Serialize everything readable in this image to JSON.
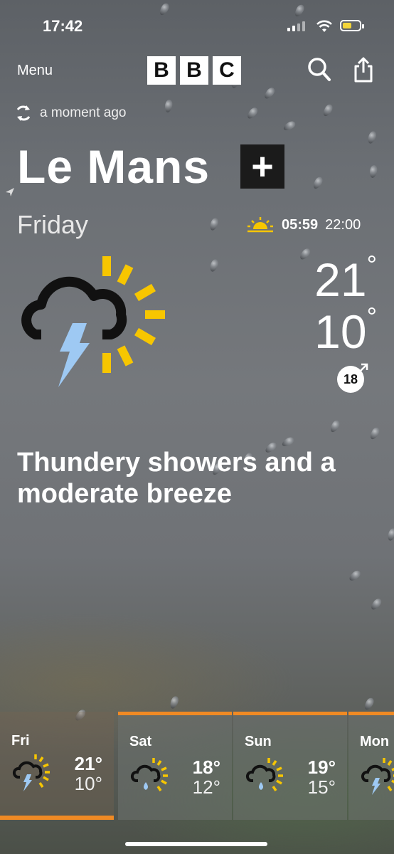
{
  "status_bar": {
    "time": "17:42"
  },
  "header": {
    "menu_label": "Menu",
    "logo": [
      "B",
      "B",
      "C"
    ]
  },
  "updated": "a moment ago",
  "location": {
    "name": "Le Mans",
    "add_label": "+"
  },
  "today": {
    "day": "Friday",
    "sunrise": "05:59",
    "sunset": "22:00",
    "high": "21",
    "low": "10",
    "degree": "°",
    "wind_speed": "18",
    "summary": "Thundery showers and a moderate breeze",
    "icon": "thundery-shower-sun-icon"
  },
  "forecast": [
    {
      "day": "Fri",
      "high": "21°",
      "low": "10°",
      "icon": "thunder-sun-icon",
      "selected": true
    },
    {
      "day": "Sat",
      "high": "18°",
      "low": "12°",
      "icon": "rain-sun-icon",
      "selected": false
    },
    {
      "day": "Sun",
      "high": "19°",
      "low": "15°",
      "icon": "rain-sun-icon",
      "selected": false
    },
    {
      "day": "Mon",
      "high": "",
      "low": "",
      "icon": "thunder-sun-icon",
      "selected": false
    }
  ],
  "colors": {
    "accent_orange": "#f08a24",
    "sun_yellow": "#f7c600",
    "lightning_blue": "#9ec9f3"
  }
}
